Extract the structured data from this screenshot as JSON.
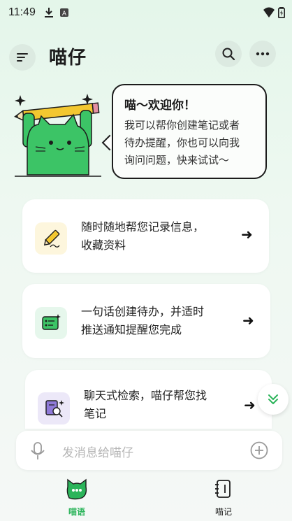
{
  "status_bar": {
    "time": "11:49",
    "left_icons": [
      "download-icon",
      "translate-icon"
    ],
    "right_icons": [
      "wifi-icon",
      "battery-icon"
    ]
  },
  "header": {
    "title": "喵仔",
    "menu_icon": "menu-icon",
    "search_icon": "search-icon",
    "more_icon": "more-icon"
  },
  "hero": {
    "greeting_title": "喵～欢迎你！",
    "greeting_lines": [
      "我可以帮你创建笔记或者",
      "待办提醒，你也可以向我",
      "询问问题，快来试试～"
    ]
  },
  "features": [
    {
      "icon": "pencil-note-icon",
      "lines": [
        "随时随地帮您记录信息，",
        "收藏资料"
      ]
    },
    {
      "icon": "todo-list-icon",
      "lines": [
        "一句话创建待办，并适时",
        "推送通知提醒您完成"
      ]
    },
    {
      "icon": "search-note-icon",
      "lines": [
        "聊天式检索，喵仔帮您找",
        "笔记"
      ]
    }
  ],
  "input": {
    "placeholder": "发消息给喵仔"
  },
  "nav": {
    "items": [
      {
        "label": "喵语",
        "icon": "cat-chat-icon",
        "active": true
      },
      {
        "label": "喵记",
        "icon": "notebook-icon",
        "active": false
      }
    ]
  },
  "colors": {
    "accent": "#2bb45a",
    "mascot": "#3cc466",
    "pencil": "#f3c730"
  }
}
